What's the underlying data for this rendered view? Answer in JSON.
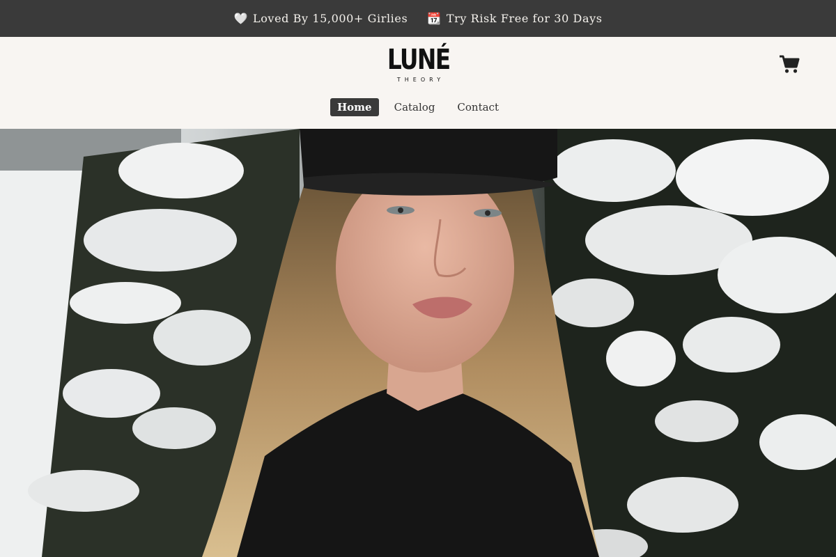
{
  "announcement": {
    "items": [
      {
        "icon": "heart-icon",
        "glyph": "🤍",
        "text": "Loved By 15,000+ Girlies"
      },
      {
        "icon": "calendar-icon",
        "glyph": "📆",
        "text": "Try Risk Free for 30 Days"
      }
    ]
  },
  "brand": {
    "name": "LUNÉ",
    "tagline": "THEORY"
  },
  "nav": {
    "items": [
      {
        "label": "Home",
        "active": true
      },
      {
        "label": "Catalog",
        "active": false
      },
      {
        "label": "Contact",
        "active": false
      }
    ]
  },
  "hero": {
    "subject": "woman in black cap and coat in front of snowy pine trees"
  }
}
